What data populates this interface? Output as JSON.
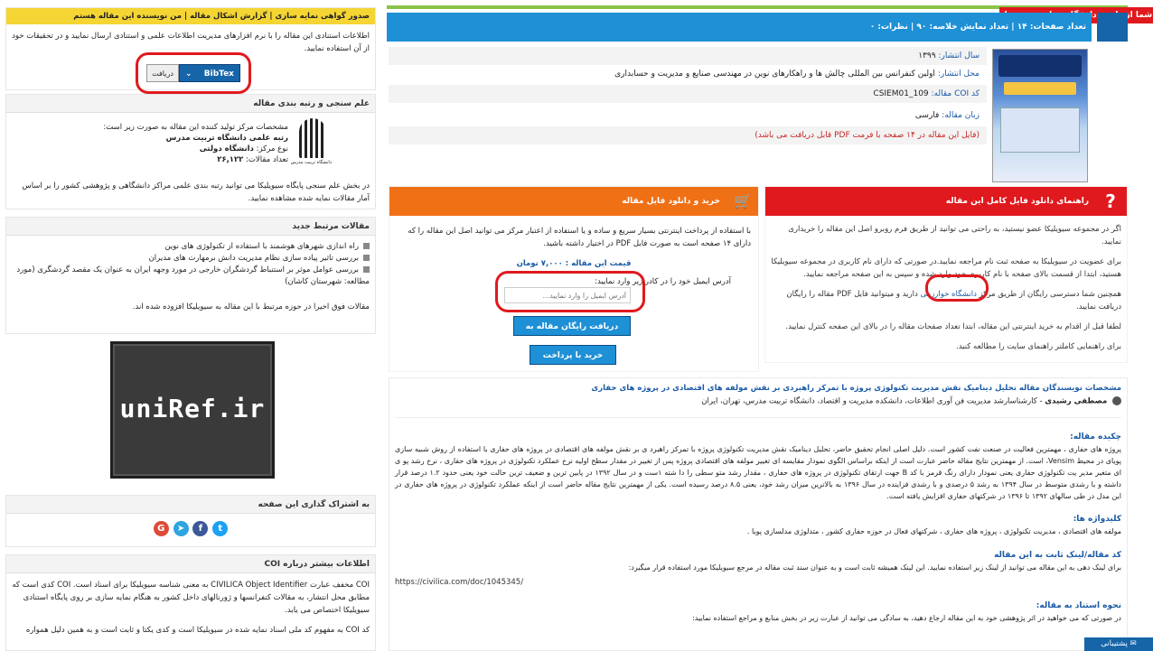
{
  "top": {
    "notice": "شما از طریق دانشگاه خوارزمی متصل شده اید",
    "stats_bar": "تعداد صفحات: ۱۴ | تعداد نمایش خلاصه: ۹۰ | نظرات: ۰"
  },
  "meta": {
    "year_label": "سال انتشار:",
    "year": "۱۳۹۹",
    "venue_label": "محل انتشار:",
    "venue": "اولین کنفرانس بین المللی چالش ها و راهکارهای نوین در مهندسی صنایع و مدیریت و حسابداری",
    "coi_label": "کد COI مقاله:",
    "coi": "CSIEM01_109",
    "lang_label": "زبان مقاله:",
    "lang": "فارسی",
    "pdf_note": "(فایل این مقاله در ۱۴ صفحه با فرمت PDF قابل دریافت می باشد)"
  },
  "guide": {
    "title": "راهنمای دانلود فایل کامل این مقاله",
    "p1": "اگر در مجموعه سیویلیکا عضو نیستید، به راحتی می توانید از طریق فرم روبرو اصل این مقاله را خریداری نمایید.",
    "p2": "برای عضویت در سیویلیکا به صفحه ثبت نام مراجعه نمایید.در صورتی که دارای نام کاربری در مجموعه سیویلیکا هستید، ابتدا از قسمت بالای صفحه با نام کاربری خود وارد شده و سپس به این صفحه مراجعه نمایید.",
    "p3_pre": "همچنین شما دسترسی رایگان از طریق مرکز",
    "p3_univ": "دانشگاه خوارزمی",
    "p3_post": "دارید و میتوانید فایل PDF مقاله را رایگان دریافت نمایید.",
    "p4": "لطفا قبل از اقدام به خرید اینترنتی این مقاله، ابتدا تعداد صفحات مقاله را در بالای این صفحه کنترل نمایید.",
    "p5": "برای راهنمایی کاملتر راهنمای سایت را مطالعه کنید."
  },
  "buy": {
    "title": "خرید و دانلود فایل مقاله",
    "desc": "با استفاده از پرداخت اینترنتی بسیار سریع و ساده و یا استفاده از اعتبار مرکز می توانید اصل این مقاله را که دارای ۱۴ صفحه است به صورت فایل PDF در اختیار داشته باشید.",
    "price": "قیمت این مقاله : ۷,۰۰۰ تومان",
    "email_label": "آدرس ایمیل خود را در کادر زیر وارد نمایید:",
    "email_placeholder": "آدرس ایمیل را وارد نمایید...",
    "free_btn": "دریافت رایگان مقاله به صورت PDF",
    "buy_btn": "خرید با پرداخت اینترنتی"
  },
  "authors": {
    "heading": "مشخصات نویسندگان مقاله تحلیل دینامیک نقش مدیریت تکنولوژی پروژه با تمرکز راهبردی بر نقش مولفه های اقتصادی در پروژه های حفاری",
    "name": "مصطفی رشیدی",
    "affil": "- کارشناسارشد مدیریت فن آوری اطلاعات، دانشکده مدیریت و اقتصاد، دانشگاه تربیت مدرس، تهران، ایران"
  },
  "abstract": {
    "title": "چکیده مقاله:",
    "text": "پروژه های حفاری ، مهمترین فعالیت در صنعت نفت کشور است. دلیل اصلی انجام تحقیق حاضر، تحلیل دینامیک نقش مدیریت تکنولوژی پروژه با تمرکز راهبرد ی بر نقش مولفه های اقتصادی در پروژه های حفاری با استفاده از روش شبیه سازی پویای در محیط Vensim، است. از مهمترین نتایج مقاله حاضر عبارت است از اینکه براساس الگوی نمودار مقایسه ای تغییر مولفه های اقتصادی پروژه پس از تغییر در مقدار سطح اولیه نرخ عملکرد تکنولوژی در پروژه های حفاری ، نرخ رشد پو ی ای متغیر مدیر یت تکنولوژی حفاری یعنی نمودار دارای رنگ قرمز با کد B جهت ارتقای تکنولوژی در پروژه های حفاری ، مقدار رشد متو سطی را دا شته ۱ست و در سال ۱۳۹۲ در پایین ترین و ضعیف ترین حالت خود یعنی حدود ۱.۲ درصد قرار داشته و با رشدی متوسط در سال ۱۳۹۴ به رشد ۵ درصدی و با رشدی فزاینده در سال ۱۳۹۶ به بالاترین میزان رشد خود، یعنی ۸.۵ درصد رسیده است. یکی از مهمترین نتایج مقاله حاضر است از اینکه عملکرد تکنولوژی در پروژه های حفاری در این مدل در طی سالهای ۱۳۹۲ تا ۱۳۹۶ در شرکتهای حفاری افزایش یافته است."
  },
  "keywords": {
    "title": "کلیدواژه ها:",
    "text": "مولفه های اقتصادی ، مدیریت تکنولوژی ، پروژه های حفاری ، شرکتهای فعال در حوزه حفاری کشور ، متدلوژی مدلسازی پویا ."
  },
  "link": {
    "title": "کد مقاله/لینک ثابت به این مقاله",
    "text": "برای لینک دهی به این مقاله می توانید از لینک زیر استفاده نمایید. این لینک همیشه ثابت است و به عنوان سند ثبت مقاله در مرجع سیویلیکا مورد استفاده قرار میگیرد:",
    "url": "https://civilica.com/doc/1045345/"
  },
  "cite": {
    "title": "نحوه استناد به مقاله:",
    "text": "در صورتی که می خواهید در اثر پژوهشی خود به این مقاله ارجاع دهید، به سادگی می توانید از عبارت زیر در بخش منابع و مراجع استفاده نمایید:"
  },
  "support_label": "پشتیبانی",
  "cert": {
    "title": "صدور گواهی نمایه سازی | گزارش اشکال مقاله | من نویسنده این مقاله هستم",
    "desc": "اطلاعات استنادی این مقاله را با نرم افزارهای مدیریت اطلاعات علمی و استنادی ارسال نمایید و در تحقیقات خود از آن استفاده نمایید.",
    "select": "BibTex",
    "get_btn": "دریافت"
  },
  "rank": {
    "title": "علم سنجی و رتبه بندی مقاله",
    "line1": "مشخصات مرکز تولید کننده این مقاله به صورت زیر است:",
    "line2": "رتبه علمی دانشگاه تربیت مدرس",
    "line3_label": "نوع مرکز:",
    "line3": "دانشگاه دولتی",
    "line4_label": "تعداد مقالات:",
    "line4": "۲۶,۱۲۲",
    "note": "در بخش علم سنجی پایگاه سیویلیکا می توانید رتبه بندی علمی مراکز دانشگاهی و پژوهشی کشور را بر اساس آمار مقالات نمایه شده مشاهده نمایید.",
    "logo_caption": "دانشگاه تربیت مدرس"
  },
  "related": {
    "title": "مقالات مرتبط جدید",
    "items": [
      "راه اندازی شهرهای هوشمند با استفاده از تکنولوژی های نوین",
      "بررسی تاثیر پیاده سازی نظام مدیریت دانش برمهارت های مدیران",
      "بررسی عوامل موثر بر استنباط گردشگران خارجی در مورد وجهه ایران به عنوان یک مقصد گردشگری (مورد مطالعه: شهرستان کاشان)"
    ],
    "footer": "مقالات فوق اخیرا در حوزه مرتبط با این مقاله به سیویلیکا افزوده شده اند."
  },
  "ad": {
    "brand": "uniRef.ir"
  },
  "share": {
    "title": "به اشتراک گذاری این صفحه"
  },
  "coi_info": {
    "title": "اطلاعات بیشتر درباره COI",
    "p1": "COI مخفف عبارت CIVILICA Object Identifier به معنی شناسه سیویلیکا برای اسناد است. COI کدی است که مطابق محل انتشار، به مقالات کنفرانسها و ژورنالهای داخل کشور به هنگام نمایه سازی بر روی پایگاه استنادی سیویلیکا اختصاص می یابد.",
    "p2": "کد COI به مفهوم کد ملی اسناد نمایه شده در سیویلیکا است و کدی یکتا و ثابت است و به همین دلیل همواره"
  },
  "colors": {
    "accent_blue": "#1e90d6",
    "orange": "#f07016",
    "red": "#e0191e",
    "link_blue": "#1a5aa6"
  },
  "icons": [
    "cart-icon",
    "question-icon",
    "chevron-down-icon",
    "google-icon",
    "telegram-icon",
    "facebook-icon",
    "twitter-icon",
    "support-icon"
  ]
}
